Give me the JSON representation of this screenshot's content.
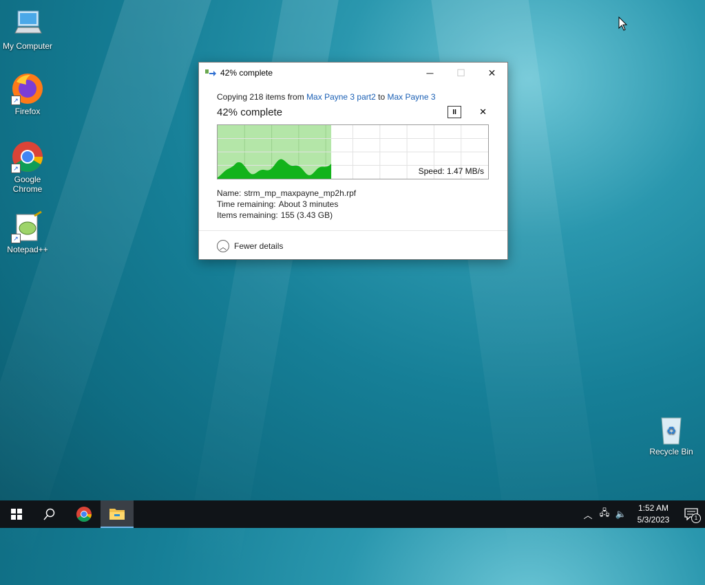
{
  "desktop": {
    "icons": [
      {
        "label": "My Computer",
        "icon": "computer-icon"
      },
      {
        "label": "Firefox",
        "icon": "firefox-icon"
      },
      {
        "label": "Google Chrome",
        "icon": "chrome-icon"
      },
      {
        "label": "Notepad++",
        "icon": "notepadpp-icon"
      },
      {
        "label": "Recycle Bin",
        "icon": "recycle-bin-icon"
      }
    ]
  },
  "dialog": {
    "title": "42% complete",
    "copy_prefix": "Copying 218 items from ",
    "source": "Max Payne 3 part2",
    "copy_to": " to ",
    "destination": "Max Payne 3",
    "percent_label": "42% complete",
    "progress_fraction": 0.42,
    "speed": "Speed: 1.47 MB/s",
    "name_label": "Name:",
    "name_value": "strm_mp_maxpayne_mp2h.rpf",
    "time_label": "Time remaining:",
    "time_value": "About 3 minutes",
    "items_label": "Items remaining:",
    "items_value": "155 (3.43 GB)",
    "fewer_details": "Fewer details",
    "pause_glyph": "II",
    "close_glyph": "✕"
  },
  "taskbar": {
    "time": "1:52 AM",
    "date": "5/3/2023",
    "notification_count": "1"
  },
  "colors": {
    "graph_fill_light": "#b4e6a8",
    "graph_fill_dark": "#13b31b",
    "link": "#1a5fb4"
  }
}
